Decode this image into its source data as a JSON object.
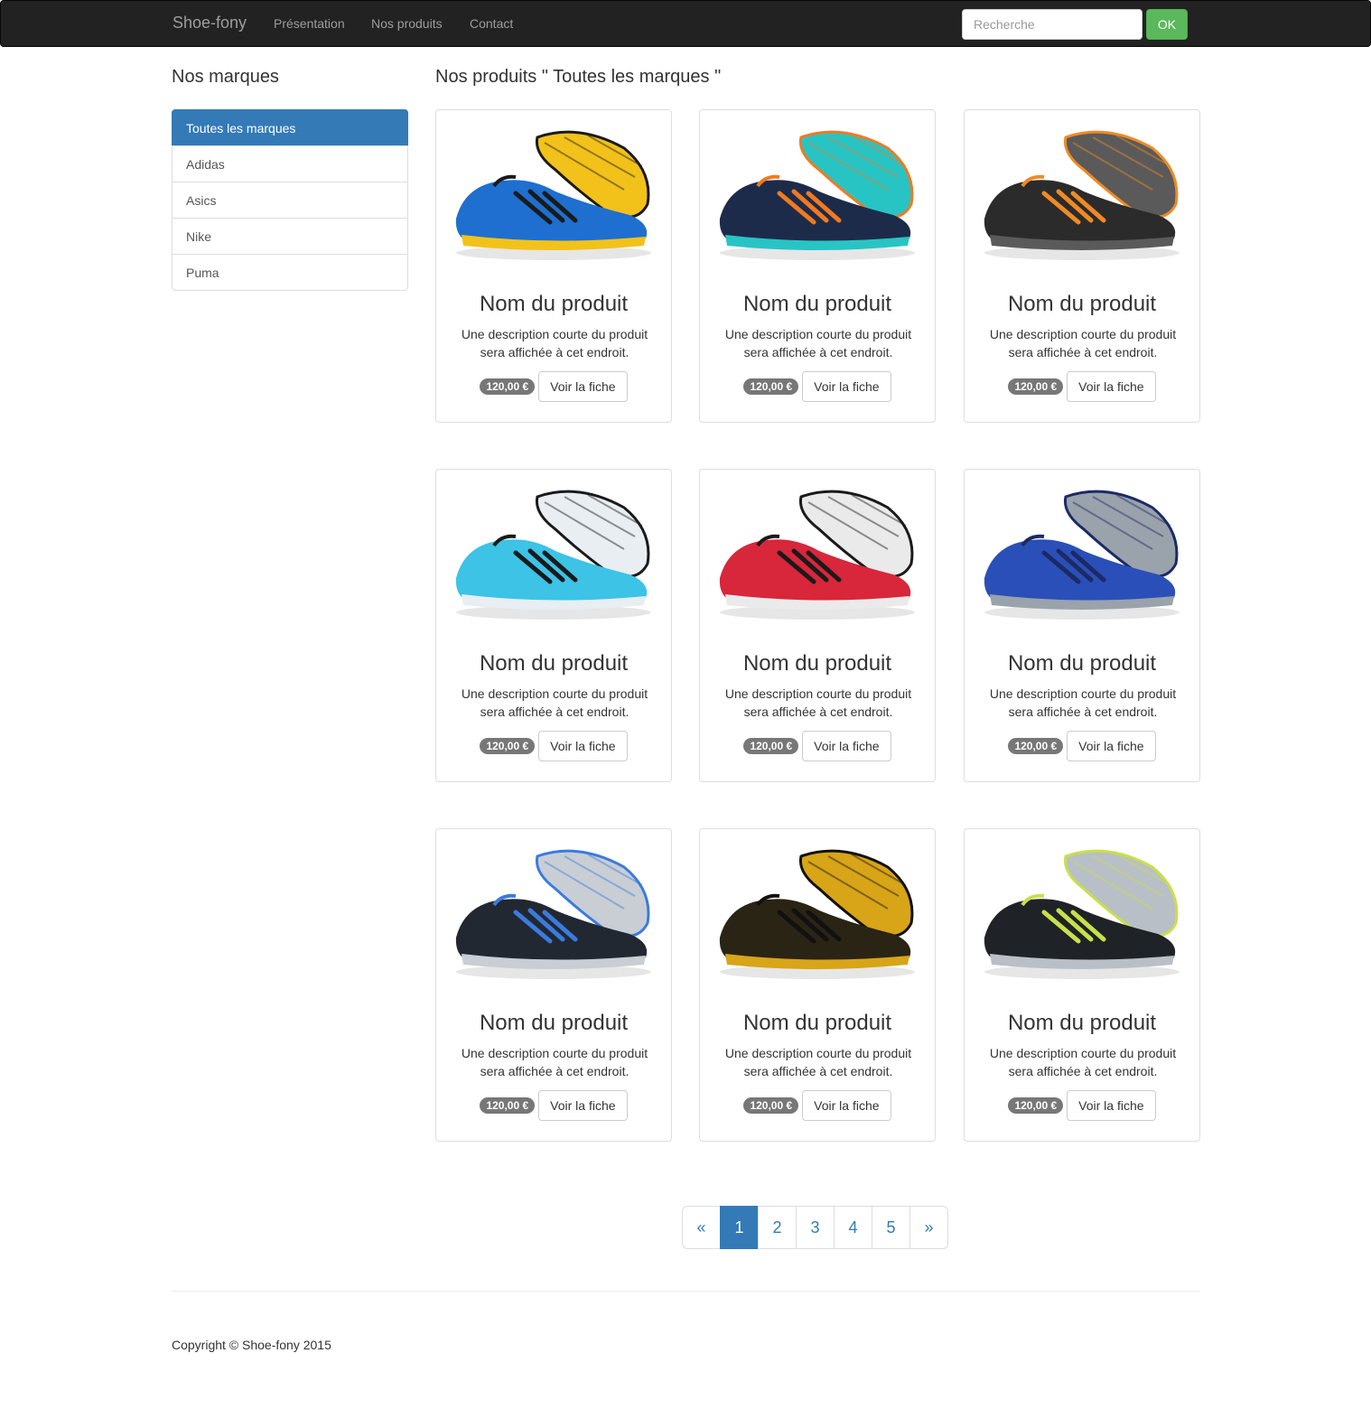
{
  "navbar": {
    "brand": "Shoe-fony",
    "links": [
      "Présentation",
      "Nos produits",
      "Contact"
    ],
    "search_placeholder": "Recherche",
    "search_button": "OK"
  },
  "sidebar": {
    "title": "Nos marques",
    "items": [
      "Toutes les marques",
      "Adidas",
      "Asics",
      "Nike",
      "Puma"
    ],
    "active_index": 0
  },
  "main": {
    "title": "Nos produits \" Toutes les marques \""
  },
  "products": [
    {
      "name": "Nom du produit",
      "desc": "Une description courte du produit sera affichée à cet endroit.",
      "price": "120,00 €",
      "button": "Voir la fiche",
      "colors": [
        "#1e6fd0",
        "#f2c21a",
        "#1a1a1a"
      ]
    },
    {
      "name": "Nom du produit",
      "desc": "Une description courte du produit sera affichée à cet endroit.",
      "price": "120,00 €",
      "button": "Voir la fiche",
      "colors": [
        "#1d2b4a",
        "#28c4c4",
        "#f07a20"
      ]
    },
    {
      "name": "Nom du produit",
      "desc": "Une description courte du produit sera affichée à cet endroit.",
      "price": "120,00 €",
      "button": "Voir la fiche",
      "colors": [
        "#2b2b2b",
        "#5a5a5a",
        "#f08a24"
      ]
    },
    {
      "name": "Nom du produit",
      "desc": "Une description courte du produit sera affichée à cet endroit.",
      "price": "120,00 €",
      "button": "Voir la fiche",
      "colors": [
        "#3cc3e6",
        "#e8eef2",
        "#1a1a1a"
      ]
    },
    {
      "name": "Nom du produit",
      "desc": "Une description courte du produit sera affichée à cet endroit.",
      "price": "120,00 €",
      "button": "Voir la fiche",
      "colors": [
        "#d8263a",
        "#eaeaea",
        "#1a1a1a"
      ]
    },
    {
      "name": "Nom du produit",
      "desc": "Une description courte du produit sera affichée à cet endroit.",
      "price": "120,00 €",
      "button": "Voir la fiche",
      "colors": [
        "#2a4fb8",
        "#9aa2ab",
        "#1c2a66"
      ]
    },
    {
      "name": "Nom du produit",
      "desc": "Une description courte du produit sera affichée à cet endroit.",
      "price": "120,00 €",
      "button": "Voir la fiche",
      "colors": [
        "#222831",
        "#c9ced4",
        "#3a7be0"
      ]
    },
    {
      "name": "Nom du produit",
      "desc": "Une description courte du produit sera affichée à cet endroit.",
      "price": "120,00 €",
      "button": "Voir la fiche",
      "colors": [
        "#2a2415",
        "#d8a418",
        "#111111"
      ]
    },
    {
      "name": "Nom du produit",
      "desc": "Une description courte du produit sera affichée à cet endroit.",
      "price": "120,00 €",
      "button": "Voir la fiche",
      "colors": [
        "#1f2226",
        "#b9bfc6",
        "#c8e04a"
      ]
    }
  ],
  "pagination": {
    "prev": "«",
    "pages": [
      "1",
      "2",
      "3",
      "4",
      "5"
    ],
    "next": "»",
    "active_index": 0
  },
  "footer": {
    "text": "Copyright © Shoe-fony 2015"
  },
  "colors": {
    "primary": "#337ab7",
    "success": "#5cb85c",
    "navbar": "#222222",
    "badge": "#777777"
  }
}
